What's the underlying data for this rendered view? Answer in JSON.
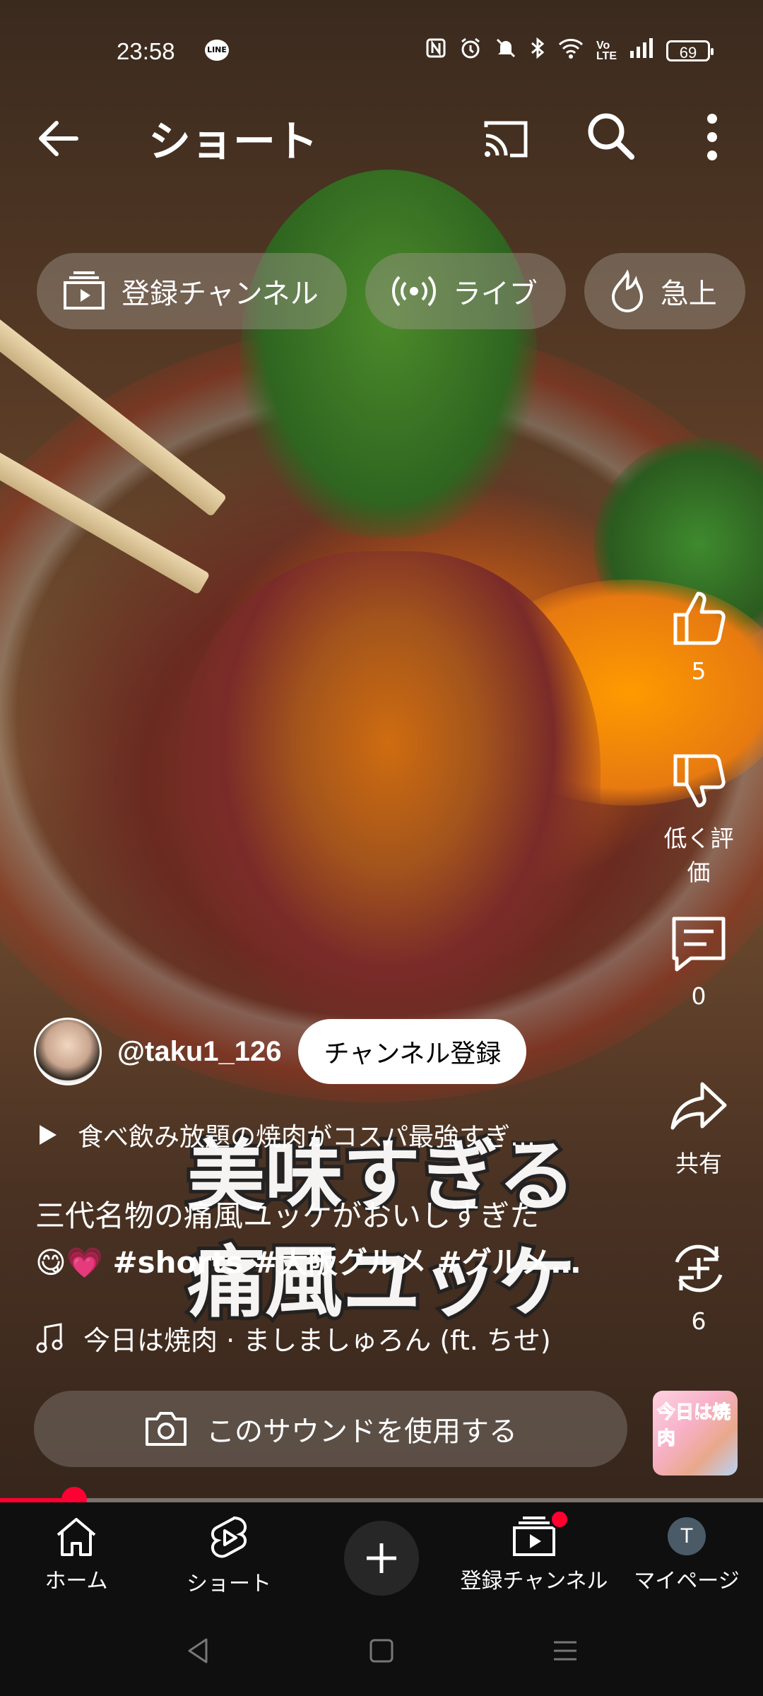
{
  "status_bar": {
    "time": "23:58",
    "line_icon": "LINE",
    "battery": "69",
    "icons": [
      "nfc-icon",
      "alarm-icon",
      "mute-icon",
      "bluetooth-icon",
      "wifi-icon",
      "volte-icon",
      "signal-icon",
      "battery-icon"
    ]
  },
  "header": {
    "title": "ショート"
  },
  "chips": [
    {
      "label": "登録チャンネル",
      "icon": "subscriptions-icon"
    },
    {
      "label": "ライブ",
      "icon": "live-icon"
    },
    {
      "label": "急上",
      "icon": "trending-icon"
    }
  ],
  "video": {
    "overlay_line1": "美味すぎる",
    "overlay_line2": "痛風ユッケ",
    "channel_handle": "@taku1_126",
    "subscribe_label": "チャンネル登録",
    "playlist_text": "食べ飲み放題の焼肉がコスパ最強すぎ…",
    "description_line1": "三代名物の痛風ユッケがおいしすぎた",
    "description_emoji": "😋💗",
    "description_tags": "#shorts #大阪グルメ #グルメ…",
    "sound_text": "今日は焼肉 · ましましゅろん (ft. ちせ)",
    "use_sound_label": "このサウンドを使用する",
    "sound_thumb_text": "今日は焼肉",
    "progress": 0.097
  },
  "actions": {
    "like_count": "5",
    "dislike_label": "低く評価",
    "comment_count": "0",
    "share_label": "共有",
    "remix_count": "6"
  },
  "bottom_nav": {
    "home": "ホーム",
    "shorts": "ショート",
    "subscriptions": "登録チャンネル",
    "mypage": "マイページ",
    "mypage_avatar_letter": "T"
  },
  "colors": {
    "accent": "#ff0033",
    "nav_bg": "#0f0f0f"
  }
}
